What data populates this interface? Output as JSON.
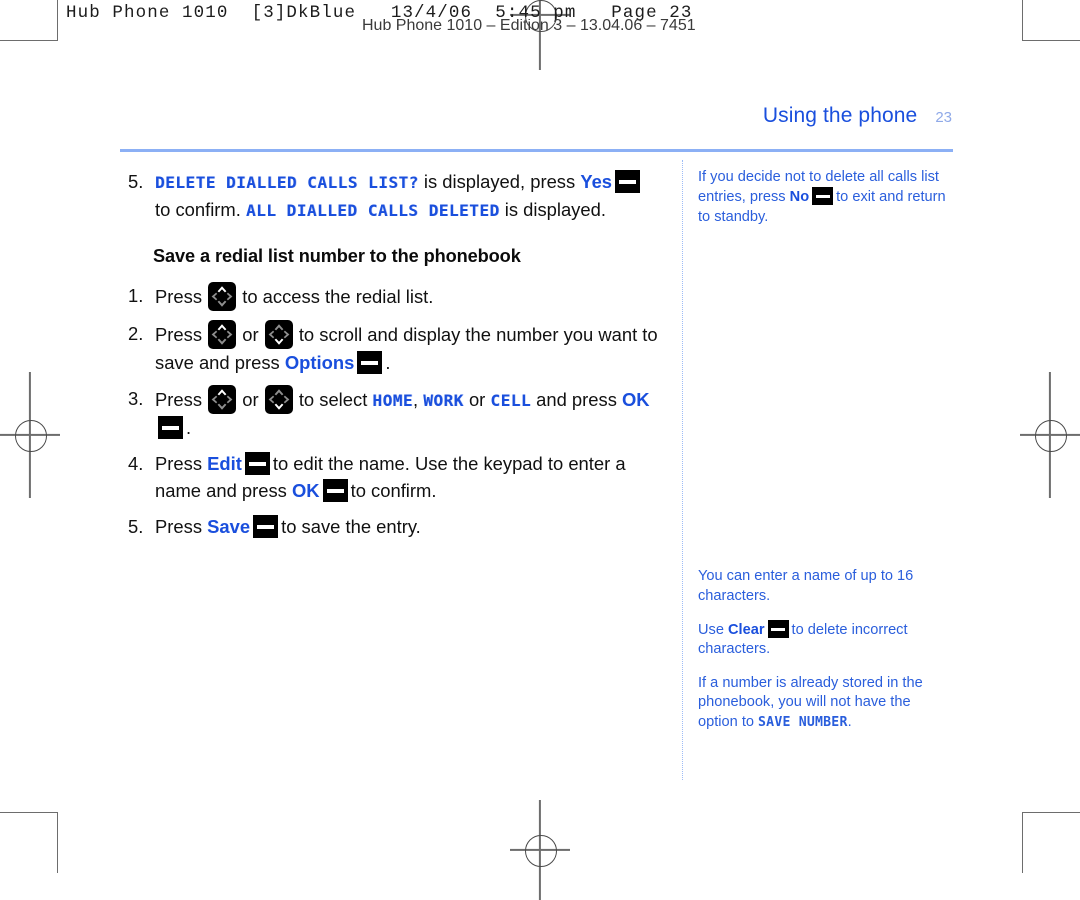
{
  "print_marks": {
    "printer_header": "Hub Phone 1010  [3]DkBlue   13/4/06  5:45 pm   Page 23",
    "edition_line": "Hub Phone 1010 – Edition 3 – 13.04.06 – 7451"
  },
  "header": {
    "title": "Using the phone",
    "page_number": "23"
  },
  "colors": {
    "accent_blue": "#1a4fdd",
    "note_blue": "#2a5edc",
    "rule_blue": "#8cb0f5",
    "page_number_blue": "#8fa9e8",
    "key_black": "#000000"
  },
  "main": {
    "step5_top": {
      "number": "5.",
      "lcd_1": "DELETE DIALLED CALLS LIST?",
      "text_1": " is displayed, press ",
      "key_label": "Yes",
      "text_2": "to confirm. ",
      "lcd_2": "ALL DIALLED CALLS DELETED",
      "text_3": " is displayed."
    },
    "section_heading": "Save a redial list number to the phonebook",
    "steps": [
      {
        "number": "1.",
        "t1": "Press ",
        "t2": " to access the redial list."
      },
      {
        "number": "2.",
        "t1": "Press ",
        "t2": " or ",
        "t3": " to scroll and display the number you want to save and press ",
        "key_label": "Options",
        "t4": "."
      },
      {
        "number": "3.",
        "t1": "Press ",
        "t2": " or ",
        "t3": " to select ",
        "lcd_1": "HOME",
        "t4": ", ",
        "lcd_2": "WORK",
        "t5": " or ",
        "lcd_3": "CELL",
        "t6": " and press ",
        "key_label": "OK",
        "t7": "."
      },
      {
        "number": "4.",
        "t1": "Press ",
        "key_label_1": "Edit",
        "t2": "to edit the name. Use the keypad to enter a name and press ",
        "key_label_2": "OK",
        "t3": "to confirm."
      },
      {
        "number": "5.",
        "t1": "Press ",
        "key_label": "Save",
        "t2": "to save the entry."
      }
    ]
  },
  "sidebar": {
    "note_1": {
      "t1": "If you decide not to delete all calls list entries, press ",
      "key_label": "No",
      "t2": "to exit and return to standby."
    },
    "note_2": {
      "text": "You can enter a name of up to 16 characters."
    },
    "note_3": {
      "t1": "Use ",
      "key_label": "Clear",
      "t2": "to delete incorrect characters."
    },
    "note_4": {
      "t1": "If a number is already stored in the phonebook, you will not have the option to ",
      "lcd": "SAVE NUMBER",
      "t2": "."
    }
  }
}
